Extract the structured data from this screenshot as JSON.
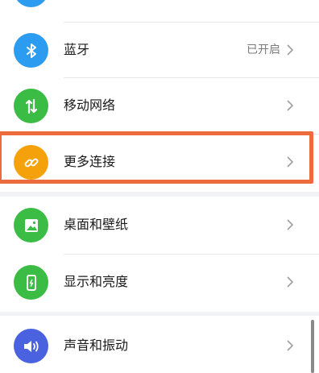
{
  "settings": {
    "items": [
      {
        "label": "",
        "value": "",
        "icon": "partial-icon",
        "color": "#2c9cf0"
      },
      {
        "label": "蓝牙",
        "value": "已开启",
        "icon": "bluetooth-icon",
        "color": "#2c9cf0"
      },
      {
        "label": "移动网络",
        "value": "",
        "icon": "mobile-data-icon",
        "color": "#3bbd45"
      },
      {
        "label": "更多连接",
        "value": "",
        "icon": "link-icon",
        "color": "#f5a10c"
      },
      {
        "label": "桌面和壁纸",
        "value": "",
        "icon": "wallpaper-icon",
        "color": "#3bbd45"
      },
      {
        "label": "显示和亮度",
        "value": "",
        "icon": "display-icon",
        "color": "#3bbd45"
      },
      {
        "label": "声音和振动",
        "value": "",
        "icon": "sound-icon",
        "color": "#4a62e0"
      }
    ]
  },
  "highlight": {
    "color": "#ec6b3c",
    "target": "更多连接"
  }
}
